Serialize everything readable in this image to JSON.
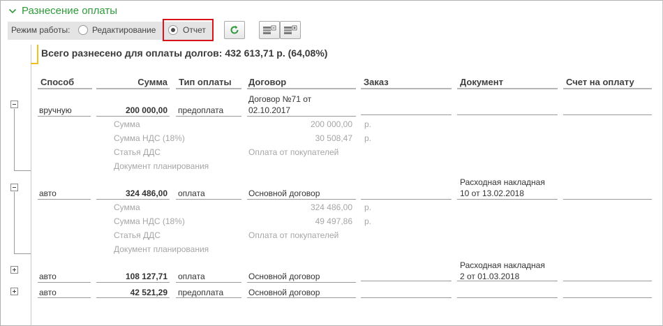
{
  "section": {
    "title": "Разнесение оплаты"
  },
  "mode": {
    "label": "Режим работы:",
    "options": [
      {
        "label": "Редактирование",
        "selected": false
      },
      {
        "label": "Отчет",
        "selected": true
      }
    ]
  },
  "toolbar": {
    "refresh_icon": "refresh-icon",
    "collapse_icon": "collapse-all-icon",
    "expand_icon": "expand-all-icon"
  },
  "summary": {
    "text": "Всего разнесено для оплаты долгов: 432 613,71 р. (64,08%)"
  },
  "table": {
    "columns": [
      "Способ",
      "Сумма",
      "Тип оплаты",
      "Договор",
      "Заказ",
      "Документ",
      "Счет на оплату"
    ],
    "rows": [
      {
        "method": "вручную",
        "amount": "200 000,00",
        "type": "предоплата",
        "contract_line1": "Договор №71 от",
        "contract_line2": "02.10.2017",
        "document_line1": "",
        "document_line2": "",
        "expanded": true,
        "details": {
          "sum_label": "Сумма",
          "sum_value": "200 000,00",
          "sum_unit": "р.",
          "vat_label": "Сумма НДС (18%)",
          "vat_value": "30 508,47",
          "vat_unit": "р.",
          "dds_label": "Статья ДДС",
          "dds_value": "Оплата от покупателей",
          "plan_label": "Документ планирования"
        }
      },
      {
        "method": "авто",
        "amount": "324 486,00",
        "type": "оплата",
        "contract_line1": "Основной договор",
        "contract_line2": "",
        "document_line1": "Расходная накладная",
        "document_line2": "10 от 13.02.2018",
        "expanded": true,
        "details": {
          "sum_label": "Сумма",
          "sum_value": "324 486,00",
          "sum_unit": "р.",
          "vat_label": "Сумма НДС (18%)",
          "vat_value": "49 497,86",
          "vat_unit": "р.",
          "dds_label": "Статья ДДС",
          "dds_value": "Оплата от покупателей",
          "plan_label": "Документ планирования"
        }
      },
      {
        "method": "авто",
        "amount": "108 127,71",
        "type": "оплата",
        "contract_line1": "Основной договор",
        "contract_line2": "",
        "document_line1": "Расходная накладная",
        "document_line2": "2 от 01.03.2018",
        "expanded": false
      },
      {
        "method": "авто",
        "amount": "42 521,29",
        "type": "предоплата",
        "contract_line1": "Основной договор",
        "contract_line2": "",
        "document_line1": "",
        "document_line2": "",
        "expanded": false
      }
    ]
  },
  "colors": {
    "accent_green": "#2f9a3a",
    "highlight_red": "#d9131a",
    "marker_yellow": "#f0c020"
  }
}
